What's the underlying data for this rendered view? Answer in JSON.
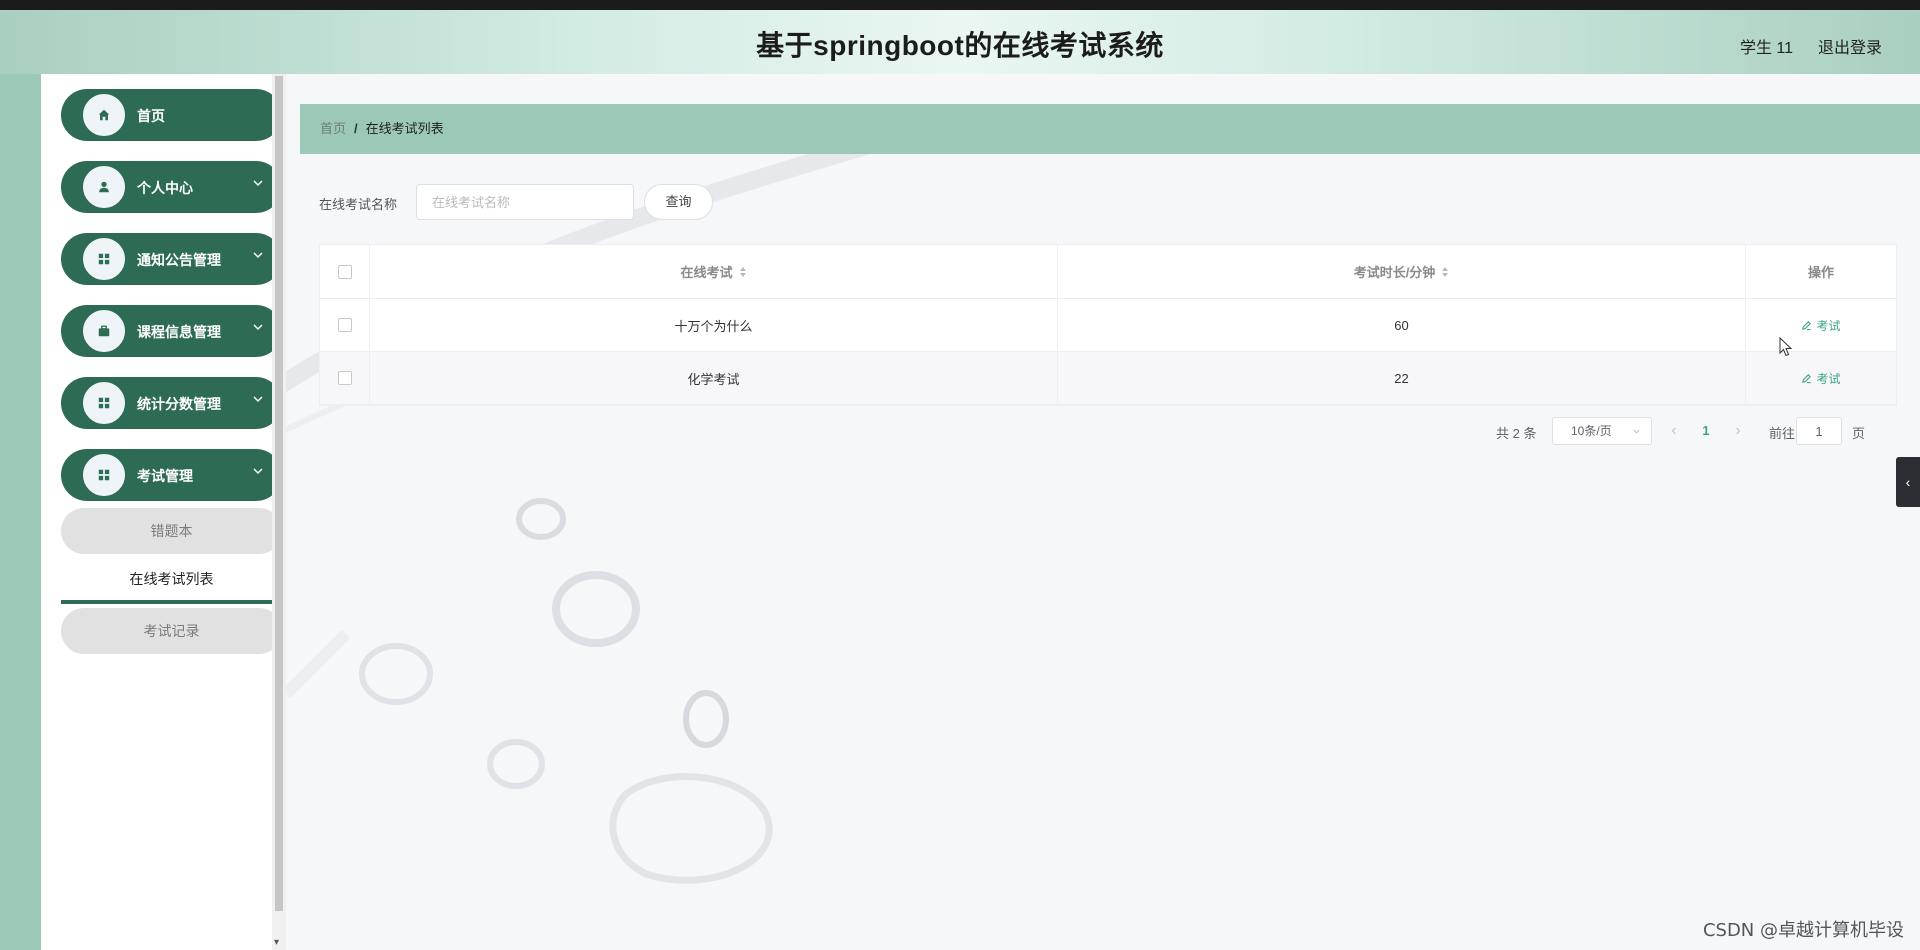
{
  "header": {
    "title": "基于springboot的在线考试系统",
    "user_name": "学生 11",
    "logout_label": "退出登录"
  },
  "sidebar": {
    "items": [
      {
        "label": "首页",
        "icon": "home-icon"
      },
      {
        "label": "个人中心",
        "icon": "user-icon"
      },
      {
        "label": "通知公告管理",
        "icon": "grid-icon"
      },
      {
        "label": "课程信息管理",
        "icon": "briefcase-icon"
      },
      {
        "label": "统计分数管理",
        "icon": "grid-icon"
      },
      {
        "label": "考试管理",
        "icon": "grid-icon"
      }
    ],
    "sub_items": [
      {
        "label": "错题本"
      },
      {
        "label": "在线考试列表",
        "active": true
      },
      {
        "label": "考试记录"
      }
    ]
  },
  "breadcrumb": {
    "home": "首页",
    "separator": "/",
    "current": "在线考试列表"
  },
  "search": {
    "label": "在线考试名称",
    "placeholder": "在线考试名称",
    "button_label": "查询"
  },
  "table": {
    "columns": [
      "在线考试",
      "考试时长/分钟",
      "操作"
    ],
    "rows": [
      {
        "name": "十万个为什么",
        "duration": "60",
        "action": "考试"
      },
      {
        "name": "化学考试",
        "duration": "22",
        "action": "考试"
      }
    ]
  },
  "pagination": {
    "total": "共 2 条",
    "page_size": "10条/页",
    "current_page": "1",
    "goto_label": "前往",
    "goto_value": "1",
    "page_suffix": "页"
  },
  "watermark": "CSDN @卓越计算机毕设",
  "colors": {
    "primary": "#2e6b55",
    "accent": "#3aa389",
    "breadcrumb_bg": "#9cc9b7"
  }
}
